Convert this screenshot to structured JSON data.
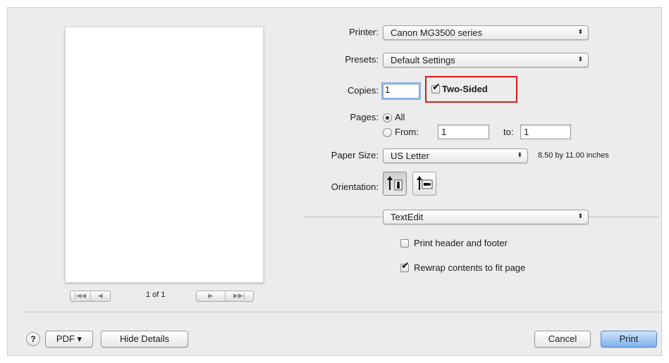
{
  "printer": {
    "label": "Printer:",
    "value": "Canon MG3500 series"
  },
  "presets": {
    "label": "Presets:",
    "value": "Default Settings"
  },
  "copies": {
    "label": "Copies:",
    "value": "1",
    "two_sided_label": "Two-Sided",
    "two_sided_checked": true
  },
  "pages": {
    "label": "Pages:",
    "all_label": "All",
    "from_label": "From:",
    "from_value": "1",
    "to_label": "to:",
    "to_value": "1",
    "selected": "All"
  },
  "paper_size": {
    "label": "Paper Size:",
    "value": "US Letter",
    "dimensions": "8.50 by 11.00 inches"
  },
  "orientation": {
    "label": "Orientation:",
    "selected": "portrait"
  },
  "section": {
    "value": "TextEdit"
  },
  "options": {
    "print_header_label": "Print header and footer",
    "print_header_checked": false,
    "rewrap_label": "Rewrap contents to fit page",
    "rewrap_checked": true
  },
  "preview": {
    "page_count": "1 of 1"
  },
  "footer": {
    "help": "?",
    "pdf": "PDF ▾",
    "hide_details": "Hide Details",
    "cancel": "Cancel",
    "print": "Print"
  },
  "colors": {
    "highlight": "#e0191f",
    "default_button": "#7fb1ee"
  }
}
